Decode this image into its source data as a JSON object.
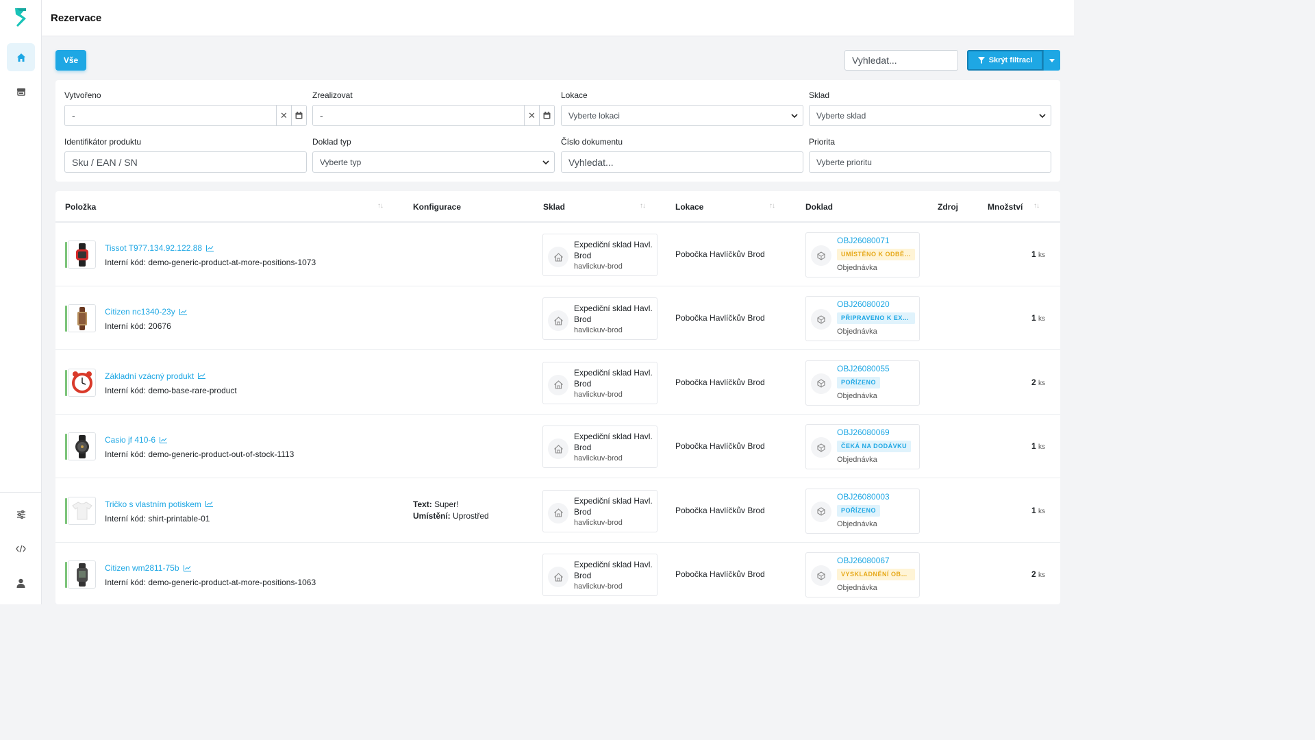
{
  "app": {
    "title": "Rezervace"
  },
  "sidebar": {
    "items": [
      {
        "name": "home-icon",
        "active": true
      },
      {
        "name": "warehouse-icon"
      },
      {
        "name": "settings-sliders-icon"
      },
      {
        "name": "code-icon"
      },
      {
        "name": "user-icon"
      }
    ]
  },
  "toolbar": {
    "tab_all": "Vše",
    "search_placeholder": "Vyhledat...",
    "filter_toggle": "Skrýt filtraci"
  },
  "filters": {
    "created": {
      "label": "Vytvořeno",
      "value": "-"
    },
    "realize": {
      "label": "Zrealizovat",
      "value": "-"
    },
    "location": {
      "label": "Lokace",
      "placeholder": "Vyberte lokaci"
    },
    "warehouse": {
      "label": "Sklad",
      "placeholder": "Vyberte sklad"
    },
    "product_id": {
      "label": "Identifikátor produktu",
      "placeholder": "Sku / EAN / SN"
    },
    "doc_type": {
      "label": "Doklad typ",
      "placeholder": "Vyberte typ"
    },
    "doc_number": {
      "label": "Číslo dokumentu",
      "placeholder": "Vyhledat..."
    },
    "priority": {
      "label": "Priorita",
      "placeholder": "Vyberte prioritu"
    }
  },
  "table": {
    "columns": {
      "item": "Položka",
      "config": "Konfigurace",
      "warehouse": "Sklad",
      "location": "Lokace",
      "document": "Doklad",
      "source": "Zdroj",
      "quantity": "Množství"
    },
    "rows": [
      {
        "name": "Tissot T977.134.92.122.88",
        "code": "Interní kód: demo-generic-product-at-more-positions-1073",
        "thumb": "watch-red",
        "config": [],
        "warehouse": "Expediční sklad Havl. Brod",
        "warehouse_slug": "havlickuv-brod",
        "location": "Pobočka Havlíčkův Brod",
        "doc_id": "OBJ26080071",
        "status": "UMÍSTĚNO K ODBĚRU",
        "status_color": "warn",
        "doc_type": "Objednávka",
        "qty": "1",
        "unit": "ks"
      },
      {
        "name": "Citizen nc1340-23y",
        "code": "Interní kód: 20676",
        "thumb": "watch-brown",
        "config": [],
        "warehouse": "Expediční sklad Havl. Brod",
        "warehouse_slug": "havlickuv-brod",
        "location": "Pobočka Havlíčkův Brod",
        "doc_id": "OBJ26080020",
        "status": "PŘIPRAVENO K EXPEDICI",
        "status_color": "info",
        "doc_type": "Objednávka",
        "qty": "1",
        "unit": "ks"
      },
      {
        "name": "Základní vzácný produkt",
        "code": "Interní kód: demo-base-rare-product",
        "thumb": "clock-red",
        "config": [],
        "warehouse": "Expediční sklad Havl. Brod",
        "warehouse_slug": "havlickuv-brod",
        "location": "Pobočka Havlíčkův Brod",
        "doc_id": "OBJ26080055",
        "status": "POŘÍZENO",
        "status_color": "info",
        "doc_type": "Objednávka",
        "qty": "2",
        "unit": "ks"
      },
      {
        "name": "Casio jf 410-6",
        "code": "Interní kód: demo-generic-product-out-of-stock-1113",
        "thumb": "watch-black",
        "config": [],
        "warehouse": "Expediční sklad Havl. Brod",
        "warehouse_slug": "havlickuv-brod",
        "location": "Pobočka Havlíčkův Brod",
        "doc_id": "OBJ26080069",
        "status": "ČEKÁ NA DODÁVKU",
        "status_color": "info",
        "doc_type": "Objednávka",
        "qty": "1",
        "unit": "ks"
      },
      {
        "name": "Tričko s vlastním potiskem",
        "code": "Interní kód: shirt-printable-01",
        "thumb": "tshirt-white",
        "config": [
          {
            "k": "Text:",
            "v": "Super!"
          },
          {
            "k": "Umístění:",
            "v": "Uprostřed"
          }
        ],
        "warehouse": "Expediční sklad Havl. Brod",
        "warehouse_slug": "havlickuv-brod",
        "location": "Pobočka Havlíčkův Brod",
        "doc_id": "OBJ26080003",
        "status": "POŘÍZENO",
        "status_color": "info",
        "doc_type": "Objednávka",
        "qty": "1",
        "unit": "ks"
      },
      {
        "name": "Citizen wm2811-75b",
        "code": "Interní kód: demo-generic-product-at-more-positions-1063",
        "thumb": "watch-grey",
        "config": [],
        "warehouse": "Expediční sklad Havl. Brod",
        "warehouse_slug": "havlickuv-brod",
        "location": "Pobočka Havlíčkův Brod",
        "doc_id": "OBJ26080067",
        "status": "VYSKLADNĚNÍ OBJEDNÁVKY",
        "status_color": "warn",
        "doc_type": "Objednávka",
        "qty": "2",
        "unit": "ks"
      }
    ]
  }
}
